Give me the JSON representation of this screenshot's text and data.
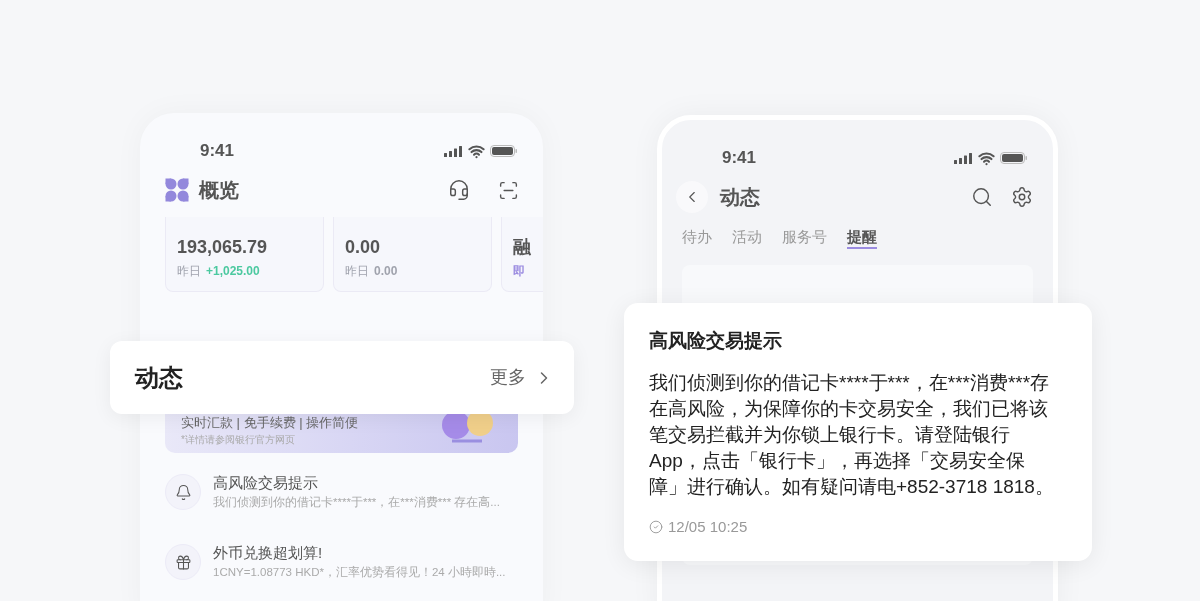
{
  "left_phone": {
    "status_time": "9:41",
    "title": "概览",
    "accounts": [
      {
        "value": "193,065.79",
        "change_label": "昨日",
        "change": "+1,025.00",
        "color": "#4cc9a0"
      },
      {
        "value": "0.00",
        "change_label": "昨日",
        "change": "0.00",
        "color": "#a0a3ad"
      },
      {
        "value": "融",
        "change": "即",
        "color": "#9b8ce0"
      }
    ],
    "banner": {
      "headline": "实时汇款 | 免手续费 | 操作简便",
      "note": "*详情请参阅银行官方网页"
    },
    "messages": [
      {
        "kind": "alert",
        "title": "高风险交易提示",
        "preview": "我们侦测到你的借记卡****于***，在***消费*** 存在高..."
      },
      {
        "kind": "offer",
        "title": "外币兑换超划算!",
        "preview": "1CNY=1.08773 HKD*，汇率优势看得见！24 小時即時..."
      }
    ]
  },
  "section_popup": {
    "title": "动态",
    "more": "更多"
  },
  "right_phone": {
    "status_time": "9:41",
    "title": "动态",
    "tabs": [
      {
        "label": "待办",
        "selected": false
      },
      {
        "label": "活动",
        "selected": false
      },
      {
        "label": "服务号",
        "selected": false
      },
      {
        "label": "提醒",
        "selected": true
      }
    ]
  },
  "detail_popup": {
    "title": "高风险交易提示",
    "body": "我们侦测到你的借记卡****于***，在***消费***存在高风险，为保障你的卡交易安全，我们已将该笔交易拦截并为你锁上银行卡。请登陆银行App，点击「银行卡」，再选择「交易安全保障」进行确认。如有疑问请电+852-3718 1818。",
    "time": "12/05 10:25"
  }
}
